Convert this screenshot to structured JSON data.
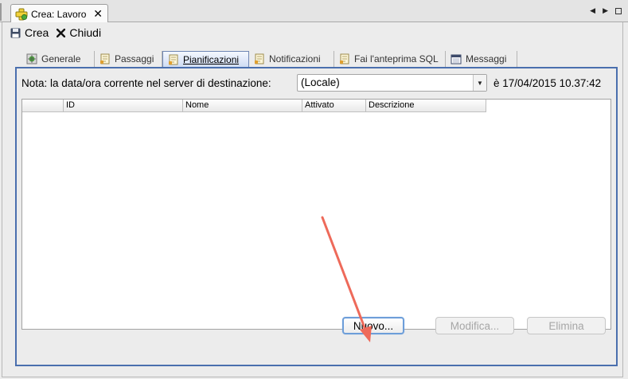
{
  "window": {
    "tab_title": "Crea: Lavoro"
  },
  "toolbar": {
    "create_label": "Crea",
    "close_label": "Chiudi"
  },
  "tabs": [
    {
      "label": "Generale",
      "icon": "general-icon"
    },
    {
      "label": "Passaggi",
      "icon": "steps-icon"
    },
    {
      "label": "Pianificazioni",
      "icon": "schedules-icon",
      "active": true
    },
    {
      "label": "Notificazioni",
      "icon": "notifications-icon"
    },
    {
      "label": "Fai l'anteprima SQL",
      "icon": "sql-preview-icon"
    },
    {
      "label": "Messaggi",
      "icon": "messages-icon"
    }
  ],
  "panel": {
    "note_label": "Nota: la data/ora corrente nel server di destinazione:",
    "timezone_selected": "(Locale)",
    "current_time": "è 17/04/2015 10.37:42"
  },
  "table": {
    "columns": [
      "",
      "ID",
      "Nome",
      "Attivato",
      "Descrizione"
    ],
    "rows": []
  },
  "buttons": {
    "new_label": "Nuovo...",
    "edit_label": "Modifica...",
    "delete_label": "Elimina"
  },
  "colors": {
    "panel_border": "#4a6fae",
    "focus_ring": "#6d9ed9",
    "annotation_arrow": "#ee6a5a"
  }
}
